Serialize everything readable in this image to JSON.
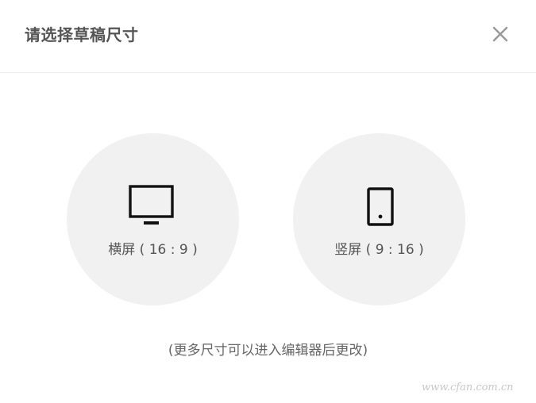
{
  "dialog": {
    "title": "请选择草稿尺寸",
    "close_icon": "close-icon"
  },
  "options": [
    {
      "label": "横屏 ( 16 : 9 )",
      "icon": "monitor-icon"
    },
    {
      "label": "竖屏 ( 9 : 16 )",
      "icon": "phone-icon"
    }
  ],
  "hint": "(更多尺寸可以进入编辑器后更改)",
  "watermark": "www.cfan.com.cn",
  "colors": {
    "title": "#555555",
    "option_background": "#f1f1f1",
    "icon": "#111111",
    "divider": "#ececec",
    "close": "#999999"
  }
}
